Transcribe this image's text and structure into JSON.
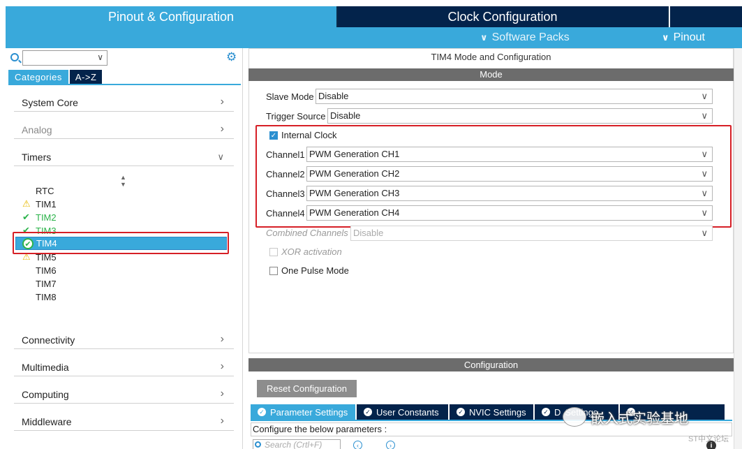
{
  "tabs": {
    "pinout_config": "Pinout & Configuration",
    "clock_config": "Clock Configuration"
  },
  "subbar": {
    "software_packs": "Software Packs",
    "pinout": "Pinout"
  },
  "left": {
    "search_value": "",
    "category_tabs": [
      "Categories",
      "A->Z"
    ],
    "categories_top": [
      {
        "label": "System Core",
        "state": "collapsed"
      },
      {
        "label": "Analog",
        "state": "collapsed",
        "disabled": true
      },
      {
        "label": "Timers",
        "state": "expanded"
      }
    ],
    "timers": [
      {
        "label": "RTC",
        "status": "none"
      },
      {
        "label": "TIM1",
        "status": "warning"
      },
      {
        "label": "TIM2",
        "status": "ok"
      },
      {
        "label": "TIM3",
        "status": "ok"
      },
      {
        "label": "TIM4",
        "status": "selected"
      },
      {
        "label": "TIM5",
        "status": "warning"
      },
      {
        "label": "TIM6",
        "status": "none"
      },
      {
        "label": "TIM7",
        "status": "none"
      },
      {
        "label": "TIM8",
        "status": "none"
      }
    ],
    "categories_bottom": [
      {
        "label": "Connectivity"
      },
      {
        "label": "Multimedia"
      },
      {
        "label": "Computing"
      },
      {
        "label": "Middleware"
      }
    ]
  },
  "mode": {
    "panel_title": "TIM4 Mode and Configuration",
    "section_title": "Mode",
    "slave_mode": {
      "label": "Slave Mode",
      "value": "Disable"
    },
    "trigger_source": {
      "label": "Trigger Source",
      "value": "Disable"
    },
    "internal_clock": {
      "label": "Internal Clock",
      "checked": true
    },
    "channels": [
      {
        "label": "Channel1",
        "value": "PWM Generation CH1"
      },
      {
        "label": "Channel2",
        "value": "PWM Generation CH2"
      },
      {
        "label": "Channel3",
        "value": "PWM Generation CH3"
      },
      {
        "label": "Channel4",
        "value": "PWM Generation CH4"
      }
    ],
    "combined_channels": {
      "label": "Combined Channels",
      "value": "Disable"
    },
    "xor_activation": {
      "label": "XOR activation",
      "checked": false
    },
    "one_pulse": {
      "label": "One Pulse Mode",
      "checked": false
    }
  },
  "config": {
    "section_title": "Configuration",
    "reset_button": "Reset Configuration",
    "param_tabs": [
      "Parameter Settings",
      "User Constants",
      "NVIC Settings",
      "D",
      "Settings"
    ],
    "instruction": "Configure the below parameters :",
    "search_placeholder": "Search (Crtl+F)"
  },
  "watermark": {
    "text": "嵌入式实验基地",
    "forum": "ST中文论坛"
  },
  "colors": {
    "accent": "#39a9db",
    "navy": "#03234b",
    "highlight": "#d61f26",
    "ok": "#2bb34a",
    "warning": "#e7b800"
  }
}
